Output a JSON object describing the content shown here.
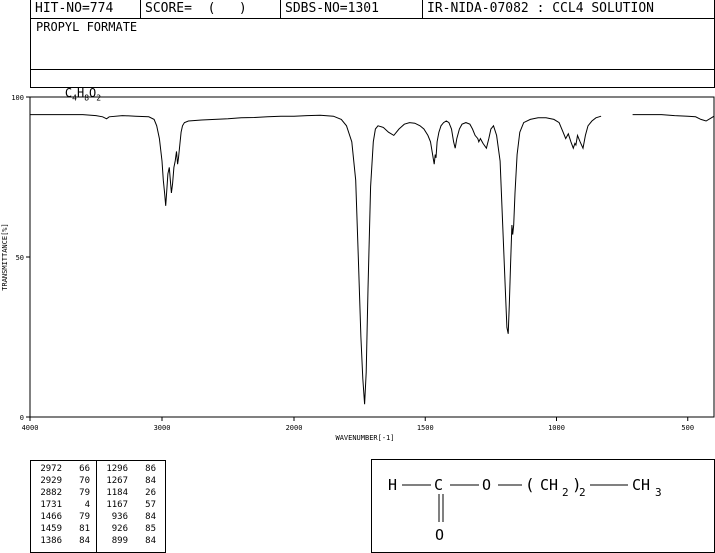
{
  "header": {
    "hit_no": "HIT-NO=774",
    "score": "SCORE=  (   )",
    "sdbs_no": "SDBS-NO=1301",
    "ir_id": "IR-NIDA-07082 : CCL4 SOLUTION"
  },
  "compound": {
    "name": "PROPYL FORMATE",
    "formula_parts": [
      "C",
      "4",
      "H",
      "8",
      "O",
      "2"
    ]
  },
  "chart_data": {
    "type": "line",
    "title": "",
    "xlabel": "WAVENUMBER[-1]",
    "ylabel": "TRANSMITTANCE[%]",
    "xlim": [
      4000,
      400
    ],
    "ylim": [
      0,
      100
    ],
    "x_ticks": [
      4000,
      3000,
      2000,
      1500,
      1000,
      500
    ],
    "y_ticks": [
      0,
      50,
      100
    ],
    "series": [
      {
        "points": [
          [
            4000,
            94.5
          ],
          [
            3800,
            94.5
          ],
          [
            3600,
            94.5
          ],
          [
            3500,
            94.2
          ],
          [
            3450,
            93.8
          ],
          [
            3420,
            93.2
          ],
          [
            3400,
            93.8
          ],
          [
            3300,
            94.2
          ],
          [
            3200,
            94.0
          ],
          [
            3100,
            93.8
          ],
          [
            3060,
            93.0
          ],
          [
            3040,
            91.0
          ],
          [
            3020,
            87.0
          ],
          [
            3000,
            80.0
          ],
          [
            2990,
            74.0
          ],
          [
            2980,
            70.0
          ],
          [
            2972,
            66.0
          ],
          [
            2965,
            70.0
          ],
          [
            2955,
            76.0
          ],
          [
            2945,
            78.0
          ],
          [
            2935,
            73.0
          ],
          [
            2929,
            70.0
          ],
          [
            2920,
            73.0
          ],
          [
            2910,
            78.0
          ],
          [
            2900,
            80.0
          ],
          [
            2890,
            83.0
          ],
          [
            2882,
            79.0
          ],
          [
            2875,
            81.0
          ],
          [
            2865,
            85.0
          ],
          [
            2855,
            89.0
          ],
          [
            2845,
            91.0
          ],
          [
            2830,
            92.0
          ],
          [
            2800,
            92.5
          ],
          [
            2700,
            92.8
          ],
          [
            2600,
            93.0
          ],
          [
            2500,
            93.2
          ],
          [
            2400,
            93.5
          ],
          [
            2300,
            93.6
          ],
          [
            2200,
            93.8
          ],
          [
            2100,
            94.0
          ],
          [
            2000,
            94.0
          ],
          [
            1950,
            94.2
          ],
          [
            1900,
            94.3
          ],
          [
            1850,
            94.0
          ],
          [
            1820,
            93.0
          ],
          [
            1800,
            91.0
          ],
          [
            1780,
            86.0
          ],
          [
            1765,
            74.0
          ],
          [
            1755,
            50.0
          ],
          [
            1745,
            25.0
          ],
          [
            1738,
            12.0
          ],
          [
            1731,
            4.0
          ],
          [
            1725,
            14.0
          ],
          [
            1718,
            40.0
          ],
          [
            1708,
            72.0
          ],
          [
            1698,
            86.0
          ],
          [
            1690,
            90.0
          ],
          [
            1680,
            91.0
          ],
          [
            1660,
            90.5
          ],
          [
            1640,
            89.0
          ],
          [
            1620,
            88.0
          ],
          [
            1600,
            90.0
          ],
          [
            1580,
            91.5
          ],
          [
            1560,
            92.0
          ],
          [
            1540,
            91.8
          ],
          [
            1520,
            91.0
          ],
          [
            1505,
            90.0
          ],
          [
            1490,
            88.0
          ],
          [
            1480,
            86.0
          ],
          [
            1472,
            82.0
          ],
          [
            1466,
            79.0
          ],
          [
            1462,
            82.0
          ],
          [
            1459,
            81.0
          ],
          [
            1455,
            86.0
          ],
          [
            1448,
            89.0
          ],
          [
            1440,
            91.0
          ],
          [
            1430,
            92.0
          ],
          [
            1420,
            92.5
          ],
          [
            1410,
            92.0
          ],
          [
            1400,
            90.0
          ],
          [
            1392,
            86.0
          ],
          [
            1386,
            84.0
          ],
          [
            1380,
            87.0
          ],
          [
            1370,
            90.0
          ],
          [
            1360,
            91.5
          ],
          [
            1345,
            92.0
          ],
          [
            1330,
            91.5
          ],
          [
            1320,
            90.0
          ],
          [
            1310,
            88.0
          ],
          [
            1300,
            87.0
          ],
          [
            1296,
            86.0
          ],
          [
            1290,
            87.0
          ],
          [
            1280,
            85.5
          ],
          [
            1267,
            84.0
          ],
          [
            1258,
            87.0
          ],
          [
            1250,
            90.0
          ],
          [
            1240,
            91.0
          ],
          [
            1228,
            88.0
          ],
          [
            1215,
            80.0
          ],
          [
            1205,
            60.0
          ],
          [
            1195,
            40.0
          ],
          [
            1189,
            28.0
          ],
          [
            1184,
            26.0
          ],
          [
            1180,
            35.0
          ],
          [
            1175,
            48.0
          ],
          [
            1170,
            60.0
          ],
          [
            1167,
            57.0
          ],
          [
            1163,
            60.0
          ],
          [
            1158,
            70.0
          ],
          [
            1150,
            82.0
          ],
          [
            1140,
            89.0
          ],
          [
            1125,
            92.0
          ],
          [
            1100,
            93.0
          ],
          [
            1070,
            93.5
          ],
          [
            1040,
            93.5
          ],
          [
            1010,
            93.0
          ],
          [
            990,
            92.0
          ],
          [
            975,
            89.0
          ],
          [
            965,
            87.0
          ],
          [
            955,
            88.5
          ],
          [
            945,
            86.0
          ],
          [
            936,
            84.0
          ],
          [
            930,
            85.5
          ],
          [
            926,
            85.0
          ],
          [
            920,
            88.0
          ],
          [
            910,
            86.0
          ],
          [
            899,
            84.0
          ],
          [
            890,
            88.0
          ],
          [
            880,
            91.0
          ],
          [
            865,
            92.5
          ],
          [
            850,
            93.5
          ],
          [
            830,
            94.0
          ]
        ]
      },
      {
        "points": [
          [
            710,
            94.5
          ],
          [
            680,
            94.5
          ],
          [
            650,
            94.5
          ],
          [
            600,
            94.5
          ],
          [
            550,
            94.2
          ],
          [
            500,
            94.0
          ],
          [
            470,
            93.8
          ],
          [
            450,
            93.0
          ],
          [
            430,
            92.5
          ],
          [
            410,
            93.5
          ],
          [
            400,
            94.0
          ]
        ]
      }
    ],
    "peak_table": [
      [
        2972,
        66
      ],
      [
        2929,
        70
      ],
      [
        2882,
        79
      ],
      [
        1731,
        4
      ],
      [
        1466,
        79
      ],
      [
        1459,
        81
      ],
      [
        1386,
        84
      ],
      [
        1296,
        86
      ],
      [
        1267,
        84
      ],
      [
        1184,
        26
      ],
      [
        1167,
        57
      ],
      [
        936,
        84
      ],
      [
        926,
        85
      ],
      [
        899,
        84
      ]
    ]
  },
  "structure": {
    "h": "H",
    "c": "C",
    "o": "O",
    "paren_open": "(",
    "ch": "CH",
    "sub2": "2",
    "paren_close": ")",
    "n": "2",
    "ch3": "CH",
    "sub3": "3",
    "carbonyl_o": "O"
  }
}
